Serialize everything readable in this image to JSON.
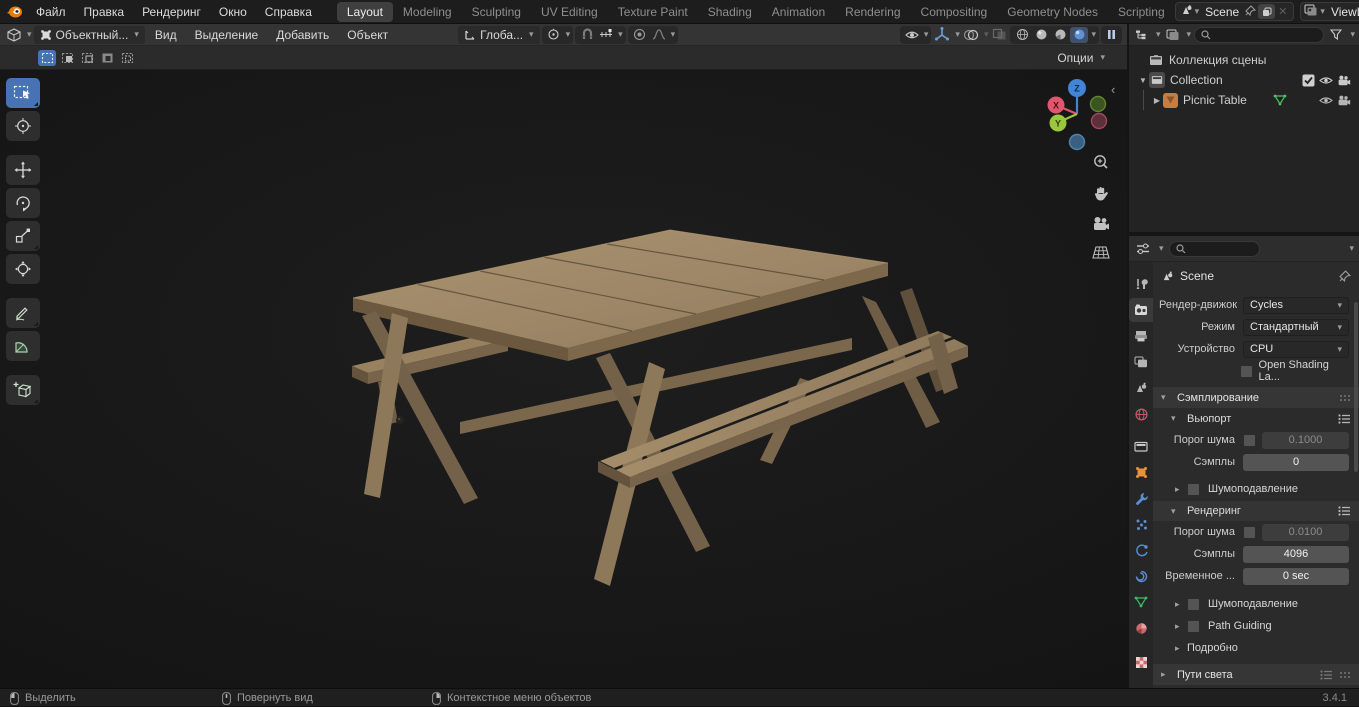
{
  "topbar": {
    "menus": [
      "Файл",
      "Правка",
      "Рендеринг",
      "Окно",
      "Справка"
    ],
    "tabs": [
      "Layout",
      "Modeling",
      "Sculpting",
      "UV Editing",
      "Texture Paint",
      "Shading",
      "Animation",
      "Rendering",
      "Compositing",
      "Geometry Nodes",
      "Scripting"
    ],
    "active_tab": "Layout",
    "scene_selector": {
      "value": "Scene"
    },
    "viewlayer_selector": {
      "value": "ViewLayer"
    }
  },
  "viewport_header": {
    "mode": "Объектный...",
    "menus": [
      "Вид",
      "Выделение",
      "Добавить",
      "Объект"
    ],
    "orientation": "Глоба..."
  },
  "tool_settings": {
    "options_label": "Опции"
  },
  "outliner": {
    "scene_collection": "Коллекция сцены",
    "collection": "Collection",
    "object": "Picnic Table"
  },
  "properties": {
    "context_name": "Scene",
    "engine": {
      "label": "Рендер-движок",
      "value": "Cycles"
    },
    "mode": {
      "label": "Режим",
      "value": "Стандартный"
    },
    "device": {
      "label": "Устройство",
      "value": "CPU"
    },
    "osl_label": "Open Shading La...",
    "sampling_title": "Сэмплирование",
    "viewport_panel": {
      "title": "Вьюпорт",
      "noise_label": "Порог шума",
      "noise_value": "0.1000",
      "samples_label": "Сэмплы",
      "samples_value": "0",
      "denoise_label": "Шумоподавление"
    },
    "render_panel": {
      "title": "Рендеринг",
      "noise_label": "Порог шума",
      "noise_value": "0.0100",
      "samples_label": "Сэмплы",
      "samples_value": "4096",
      "time_label": "Временное ...",
      "time_value": "0 sec",
      "denoise_label": "Шумоподавление",
      "path_guiding_label": "Path Guiding",
      "advanced_label": "Подробно"
    },
    "light_paths_title": "Пути света"
  },
  "status_bar": {
    "left_click": "Выделить",
    "middle_click": "Повернуть вид",
    "right_click": "Контекстное меню объектов",
    "version": "3.4.1"
  },
  "colors": {
    "accent": "#4772b3",
    "axis_x": "#e0566c",
    "axis_y": "#9ac73b",
    "axis_z": "#4085d6",
    "wood": "#a18a68",
    "object_icon_orange": "#c77d3e",
    "mesh_data_green": "#4ec161"
  }
}
